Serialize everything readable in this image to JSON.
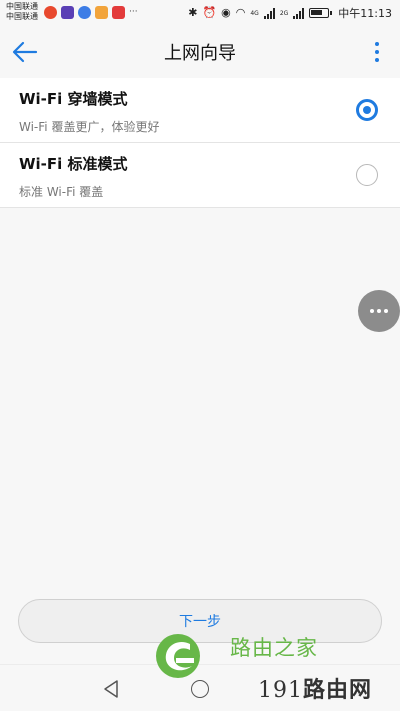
{
  "status_bar": {
    "carrier_1": "中国联通",
    "carrier_2": "中国联通",
    "network_1": "4G",
    "network_2": "2G",
    "time": "中午11:13"
  },
  "app_bar": {
    "title": "上网向导"
  },
  "options": [
    {
      "title": "Wi-Fi 穿墙模式",
      "subtitle": "Wi-Fi 覆盖更广，体验更好",
      "selected": true
    },
    {
      "title": "Wi-Fi 标准模式",
      "subtitle": "标准 Wi-Fi 覆盖",
      "selected": false
    }
  ],
  "actions": {
    "next_label": "下一步"
  },
  "watermark": {
    "brand": "路由之家",
    "site_prefix": "191",
    "site_text": "路由网"
  },
  "colors": {
    "accent": "#1f7be0",
    "brand_green": "#67b748"
  }
}
